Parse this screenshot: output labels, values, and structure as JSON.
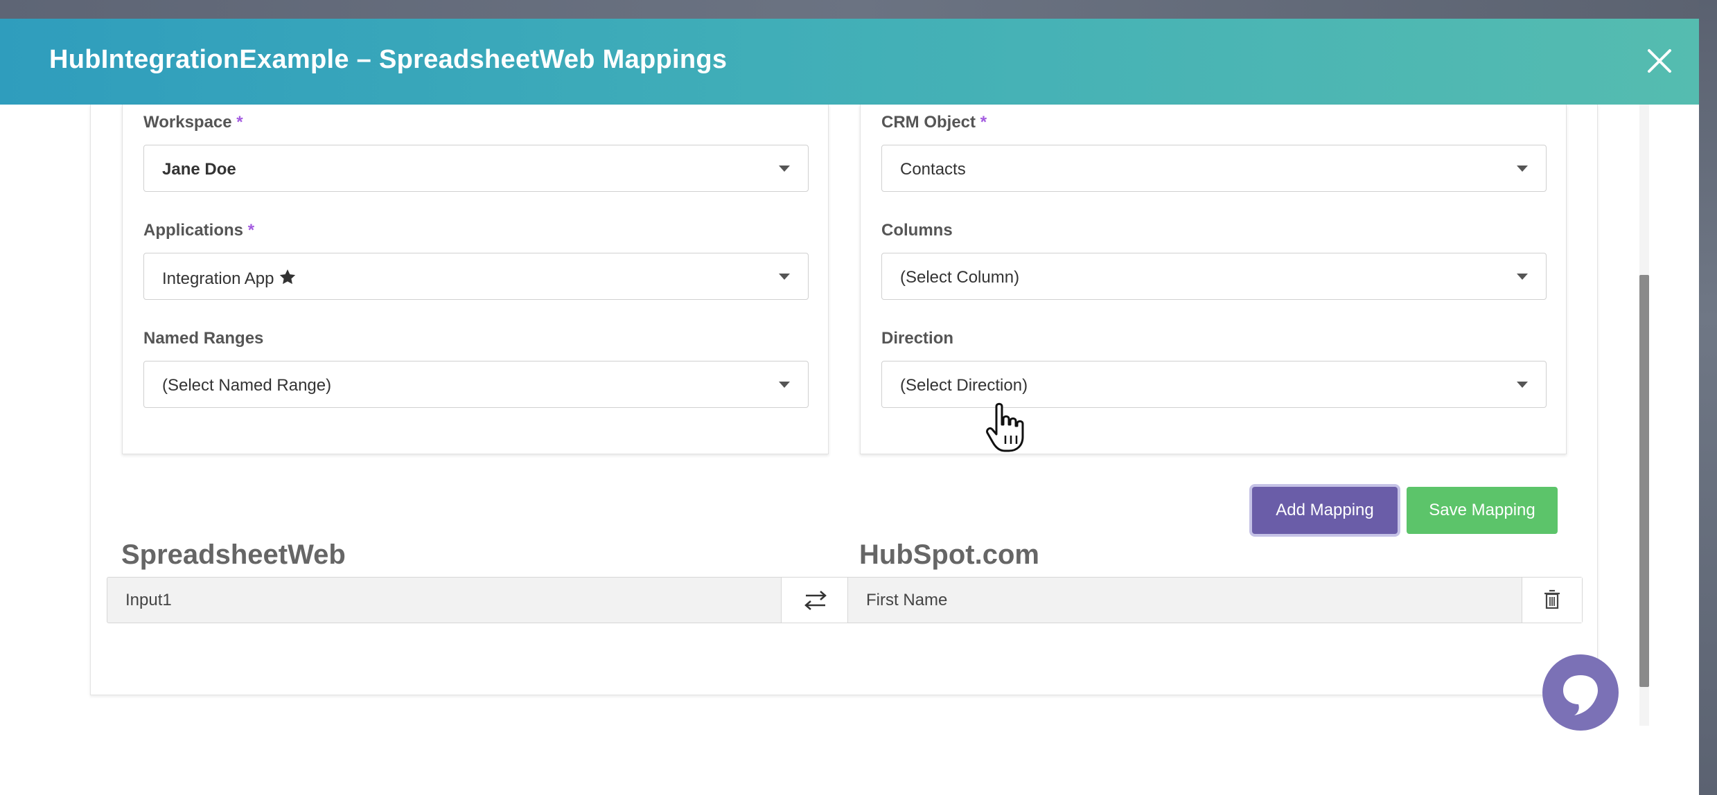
{
  "modal": {
    "title": "HubIntegrationExample – SpreadsheetWeb Mappings"
  },
  "left_panel": {
    "workspace": {
      "label": "Workspace",
      "required": "*",
      "value": "Jane Doe"
    },
    "applications": {
      "label": "Applications",
      "required": "*",
      "value": "Integration App"
    },
    "named_ranges": {
      "label": "Named Ranges",
      "value": "(Select Named Range)"
    }
  },
  "right_panel": {
    "crm_object": {
      "label": "CRM Object",
      "required": "*",
      "value": "Contacts"
    },
    "columns": {
      "label": "Columns",
      "value": "(Select Column)"
    },
    "direction": {
      "label": "Direction",
      "value": "(Select Direction)"
    }
  },
  "actions": {
    "add_label": "Add Mapping",
    "save_label": "Save Mapping"
  },
  "mappings": {
    "left_title": "SpreadsheetWeb",
    "right_title": "HubSpot.com",
    "rows": [
      {
        "source": "Input1",
        "target": "First Name"
      }
    ]
  },
  "colors": {
    "header_start": "#2f9dbd",
    "header_end": "#55bcb0",
    "required_mark": "#a35be0",
    "add_button": "#6a5da8",
    "save_button": "#5cc46a",
    "chat": "#7b71b6"
  },
  "icons": {
    "close": "close-icon",
    "star": "star-icon",
    "swap": "swap-arrows-icon",
    "delete": "trash-icon",
    "chat": "chat-icon",
    "cursor": "hand-cursor-icon"
  }
}
